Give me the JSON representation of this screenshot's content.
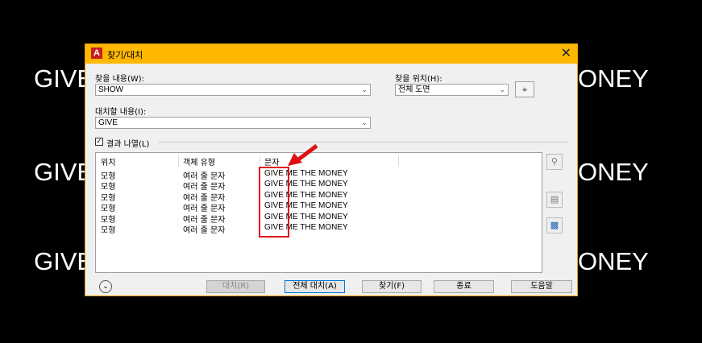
{
  "background": {
    "texts": [
      {
        "left": "GIVE",
        "right": "ONEY"
      },
      {
        "left": "GIVE",
        "right": "ONEY"
      },
      {
        "left": "GIVE",
        "right": "ONEY"
      }
    ]
  },
  "dialog": {
    "title": "찾기/대치",
    "app_logo": "A",
    "close": "✕"
  },
  "find_what": {
    "label": "찾을 내용(W):",
    "value": "SHOW"
  },
  "replace_with": {
    "label": "대치할 내용(I):",
    "value": "GIVE"
  },
  "find_where": {
    "label": "찾을 위치(H):",
    "value": "전체 도면"
  },
  "list_results": {
    "label": "결과 나열(L)",
    "checked": true
  },
  "results": {
    "headers": [
      "위치",
      "객체 유형",
      "문자"
    ],
    "rows": [
      [
        "모형",
        "여러 줄 문자",
        "GIVE ME THE MONEY"
      ],
      [
        "모형",
        "여러 줄 문자",
        "GIVE ME THE MONEY"
      ],
      [
        "모형",
        "여러 줄 문자",
        "GIVE ME THE MONEY"
      ],
      [
        "모형",
        "여러 줄 문자",
        "GIVE ME THE MONEY"
      ],
      [
        "모형",
        "여러 줄 문자",
        "GIVE ME THE MONEY"
      ],
      [
        "모형",
        "여러 줄 문자",
        "GIVE ME THE MONEY"
      ]
    ]
  },
  "buttons": {
    "replace": "대치(R)",
    "replace_all": "전체 대치(A)",
    "find": "찾기(F)",
    "done": "종료",
    "help": "도움말"
  },
  "colors": {
    "title_bar": "#ffb800",
    "highlight": "#e01010"
  }
}
